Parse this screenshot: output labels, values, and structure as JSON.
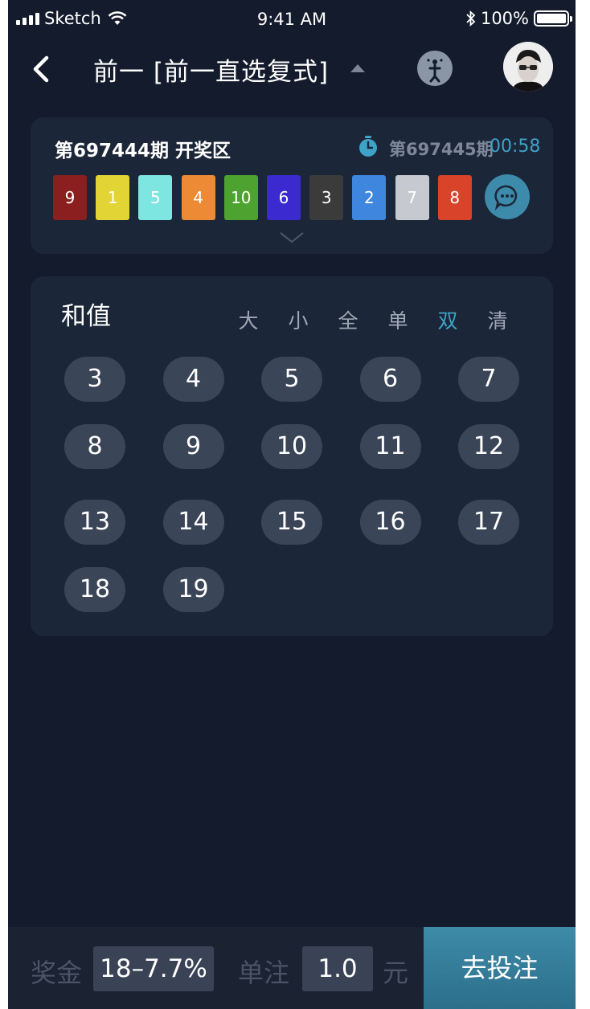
{
  "status_bar": {
    "carrier": "Sketch",
    "time": "9:41 AM",
    "battery": "100%"
  },
  "nav": {
    "title": "前一 [前一直选复式]"
  },
  "draw": {
    "current_period": "第697444期 开奖区",
    "next_period": "第697445期",
    "countdown": "00:58",
    "balls": [
      {
        "value": "9",
        "color": "#8b1f1f"
      },
      {
        "value": "1",
        "color": "#e3d435"
      },
      {
        "value": "5",
        "color": "#7ee6e0"
      },
      {
        "value": "4",
        "color": "#ec8a35"
      },
      {
        "value": "10",
        "color": "#4ea22f"
      },
      {
        "value": "6",
        "color": "#3a2ad0"
      },
      {
        "value": "3",
        "color": "#3b3b3b"
      },
      {
        "value": "2",
        "color": "#3f86de"
      },
      {
        "value": "7",
        "color": "#c6c9cf"
      },
      {
        "value": "8",
        "color": "#d8432a"
      }
    ]
  },
  "sum_panel": {
    "title": "和值",
    "filters": [
      "大",
      "小",
      "全",
      "单",
      "双",
      "清"
    ],
    "active_filter": "双",
    "numbers": [
      "3",
      "4",
      "5",
      "6",
      "7",
      "8",
      "9",
      "10",
      "11",
      "12",
      "13",
      "14",
      "15",
      "16",
      "17",
      "18",
      "19"
    ]
  },
  "bottom_bar": {
    "bonus_label": "奖金",
    "bonus_value": "18–7.7%",
    "unit_label": "单注",
    "unit_value": "1.0",
    "currency": "元",
    "submit_label": "去投注"
  },
  "colors": {
    "background": "#131b2c",
    "card": "#1b2638",
    "accent": "#3ea3c7",
    "chip": "#3b4558"
  },
  "icons": [
    "back-icon",
    "caret-up-icon",
    "help-icon",
    "avatar",
    "timer-icon",
    "chat-icon",
    "chevron-down-icon"
  ]
}
